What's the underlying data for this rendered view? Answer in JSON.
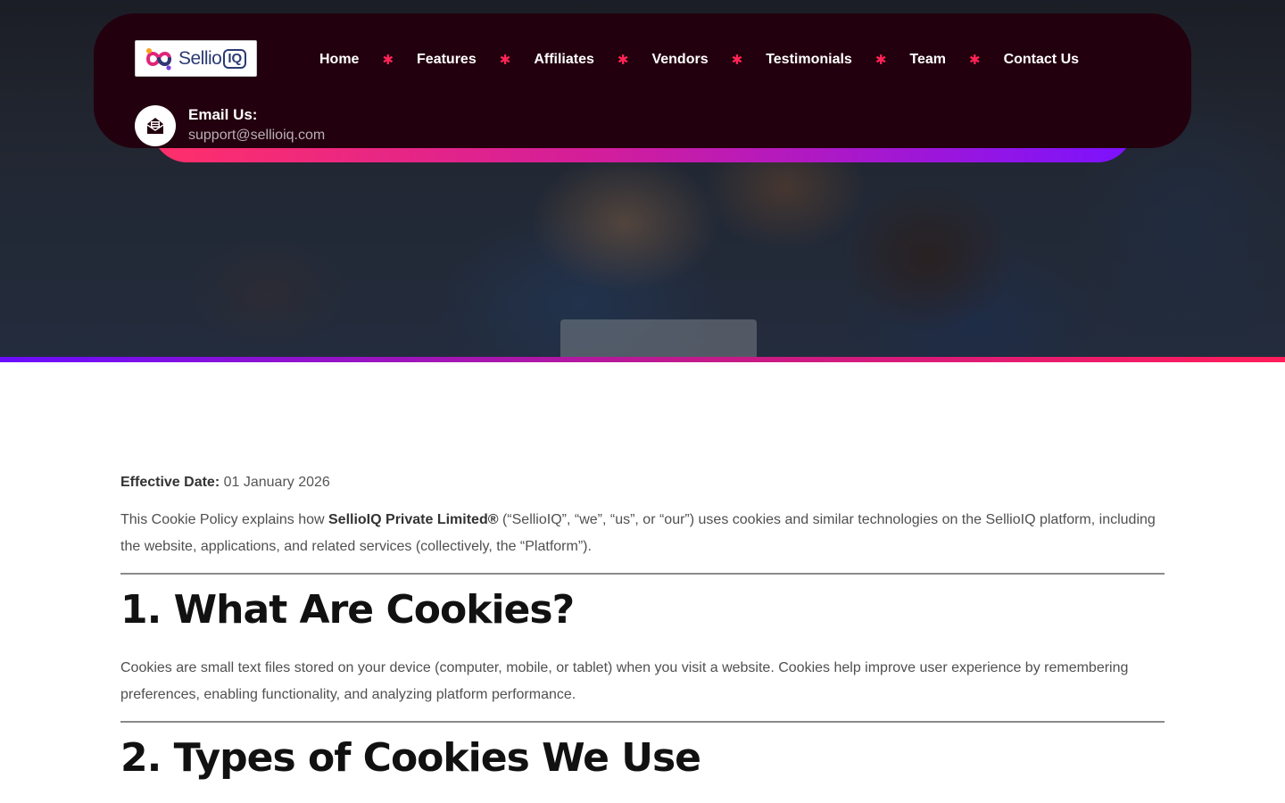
{
  "header": {
    "logo": {
      "brand_text": "Sellio",
      "brand_badge": "IQ"
    },
    "nav": [
      {
        "label": "Home"
      },
      {
        "label": "Features"
      },
      {
        "label": "Affiliates"
      },
      {
        "label": "Vendors"
      },
      {
        "label": "Testimonials"
      },
      {
        "label": "Team"
      },
      {
        "label": "Contact Us"
      }
    ],
    "separator_glyph": "✱",
    "email": {
      "label": "Email Us:",
      "value": "support@sellioiq.com",
      "icon": "envelope-open-icon"
    }
  },
  "colors": {
    "header_bg": "#23000e",
    "accent_pink": "#ff2457",
    "accent_purple": "#7b12ff",
    "heading": "#111111"
  },
  "content": {
    "effective_date_label": "Effective Date:",
    "effective_date_value": "01 January 2026",
    "intro_before": "This Cookie Policy explains how ",
    "intro_company": "SellioIQ Private Limited®",
    "intro_after": " (“SellioIQ”, “we”, “us”, or “our”) uses cookies and similar technologies on the SellioIQ platform, including the website, applications, and related services (collectively, the “Platform”).",
    "section1_title": "1. What Are Cookies?",
    "section1_body": "Cookies are small text files stored on your device (computer, mobile, or tablet) when you visit a website. Cookies help improve user experience by remembering preferences, enabling functionality, and analyzing platform performance.",
    "section2_title": "2. Types of Cookies We Use"
  }
}
